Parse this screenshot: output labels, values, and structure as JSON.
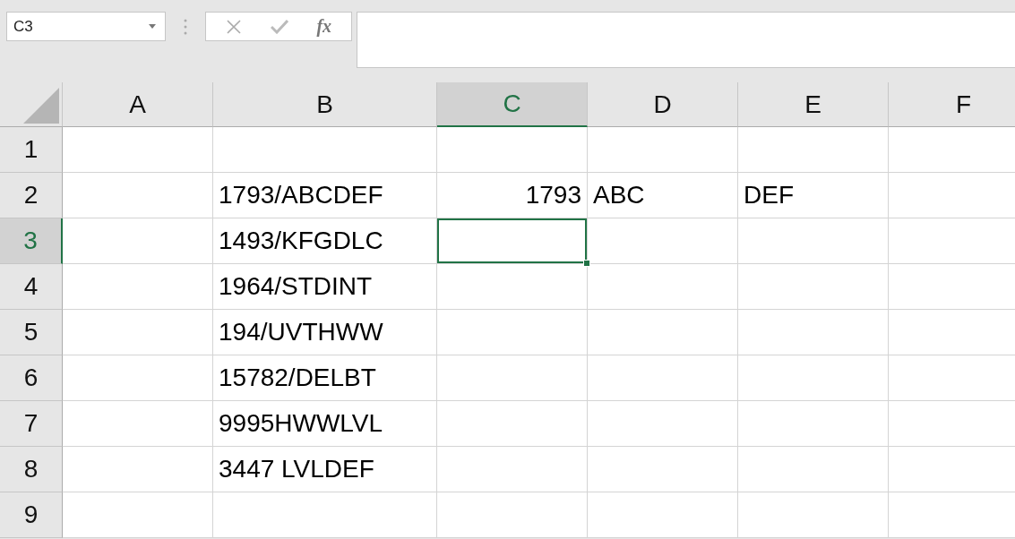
{
  "name_box": {
    "value": "C3"
  },
  "formula_bar": {
    "function_label": "fx"
  },
  "columns": [
    {
      "label": "A",
      "selected": false
    },
    {
      "label": "B",
      "selected": false
    },
    {
      "label": "C",
      "selected": true
    },
    {
      "label": "D",
      "selected": false
    },
    {
      "label": "E",
      "selected": false
    },
    {
      "label": "F",
      "selected": false
    }
  ],
  "rows": [
    {
      "label": "1",
      "selected": false,
      "cells": [
        {
          "selected": false
        },
        {
          "selected": false
        },
        {
          "selected": false
        },
        {
          "selected": false
        },
        {
          "selected": false
        },
        {
          "selected": false
        }
      ]
    },
    {
      "label": "2",
      "selected": false,
      "cells": [
        {
          "selected": false
        },
        {
          "selected": false,
          "kind": "text",
          "text": "1793/ABCDEF"
        },
        {
          "selected": false,
          "kind": "number",
          "text": "1793"
        },
        {
          "selected": false,
          "kind": "text",
          "text": "ABC"
        },
        {
          "selected": false,
          "kind": "text",
          "text": "DEF"
        },
        {
          "selected": false
        }
      ]
    },
    {
      "label": "3",
      "selected": true,
      "cells": [
        {
          "selected": false
        },
        {
          "selected": false,
          "kind": "text",
          "text": "1493/KFGDLC"
        },
        {
          "selected": true
        },
        {
          "selected": false
        },
        {
          "selected": false
        },
        {
          "selected": false
        }
      ]
    },
    {
      "label": "4",
      "selected": false,
      "cells": [
        {
          "selected": false
        },
        {
          "selected": false,
          "kind": "text",
          "text": "1964/STDINT"
        },
        {
          "selected": false
        },
        {
          "selected": false
        },
        {
          "selected": false
        },
        {
          "selected": false
        }
      ]
    },
    {
      "label": "5",
      "selected": false,
      "cells": [
        {
          "selected": false
        },
        {
          "selected": false,
          "kind": "text",
          "text": "194/UVTHWW"
        },
        {
          "selected": false
        },
        {
          "selected": false
        },
        {
          "selected": false
        },
        {
          "selected": false
        }
      ]
    },
    {
      "label": "6",
      "selected": false,
      "cells": [
        {
          "selected": false
        },
        {
          "selected": false,
          "kind": "text",
          "text": "15782/DELBT"
        },
        {
          "selected": false
        },
        {
          "selected": false
        },
        {
          "selected": false
        },
        {
          "selected": false
        }
      ]
    },
    {
      "label": "7",
      "selected": false,
      "cells": [
        {
          "selected": false
        },
        {
          "selected": false,
          "kind": "text",
          "text": "9995HWWLVL"
        },
        {
          "selected": false
        },
        {
          "selected": false
        },
        {
          "selected": false
        },
        {
          "selected": false
        }
      ]
    },
    {
      "label": "8",
      "selected": false,
      "cells": [
        {
          "selected": false
        },
        {
          "selected": false,
          "kind": "text",
          "text": "3447 LVLDEF"
        },
        {
          "selected": false
        },
        {
          "selected": false
        },
        {
          "selected": false
        },
        {
          "selected": false
        }
      ]
    },
    {
      "label": "9",
      "selected": false,
      "cells": [
        {
          "selected": false
        },
        {
          "selected": false
        },
        {
          "selected": false
        },
        {
          "selected": false
        },
        {
          "selected": false
        },
        {
          "selected": false
        }
      ]
    }
  ]
}
